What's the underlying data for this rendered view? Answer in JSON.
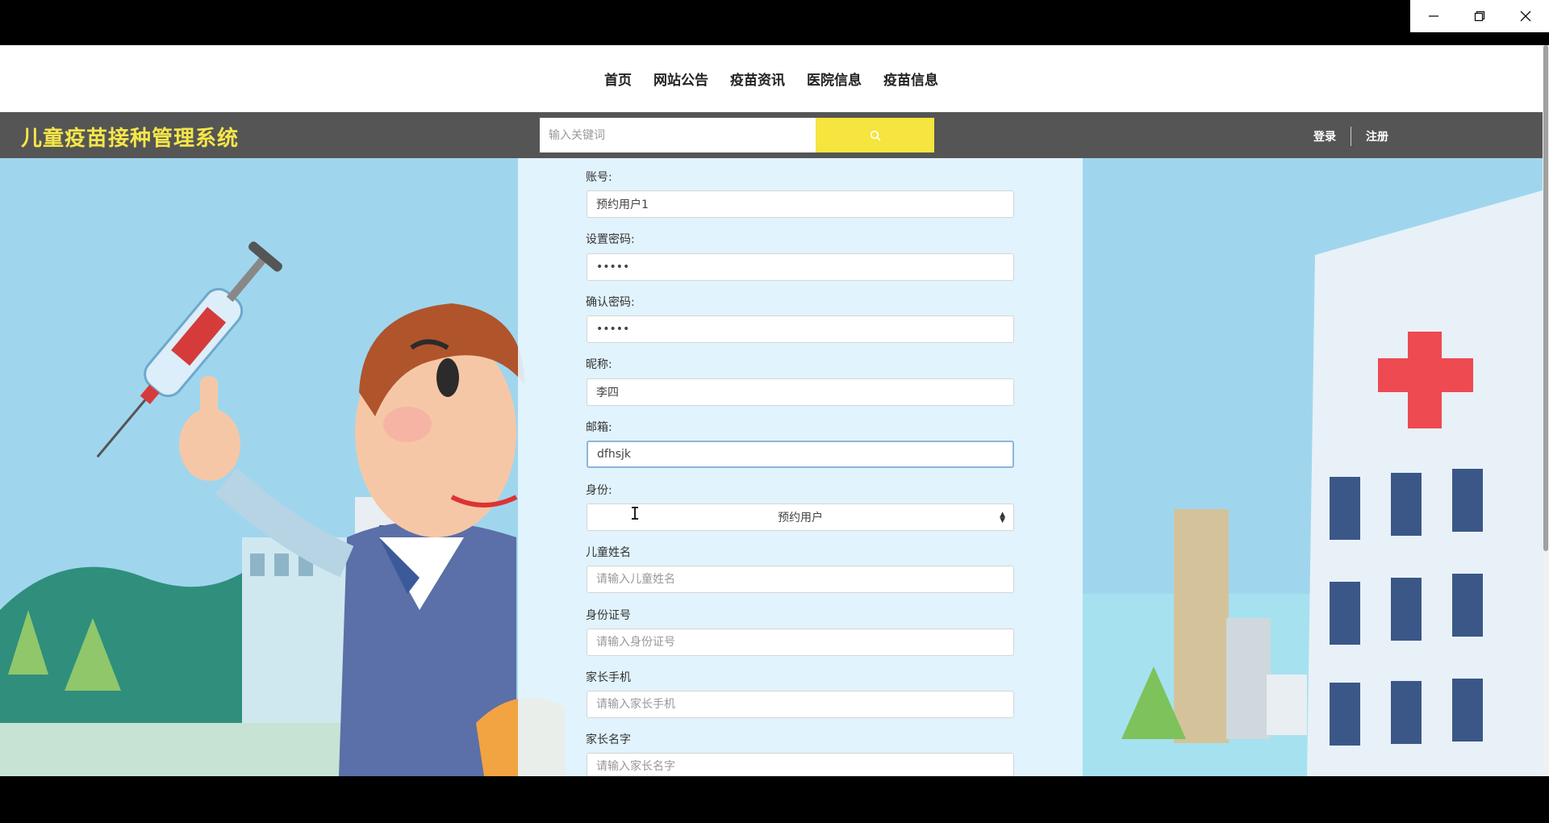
{
  "window": {
    "minimize_icon": "minimize-icon",
    "restore_icon": "restore-icon",
    "close_icon": "close-icon"
  },
  "nav": {
    "items": [
      "首页",
      "网站公告",
      "疫苗资讯",
      "医院信息",
      "疫苗信息"
    ]
  },
  "header": {
    "title": "儿童疫苗接种管理系统",
    "search_placeholder": "输入关键词",
    "search_icon": "search-icon",
    "login": "登录",
    "register": "注册"
  },
  "colors": {
    "title": "#f5e64a",
    "header_bg": "#555555",
    "search_button": "#f6e43f",
    "scene_bg": "#9fd6ee"
  },
  "form": {
    "account": {
      "label": "账号:",
      "value": "预约用户1"
    },
    "password": {
      "label": "设置密码:",
      "value": "•••••"
    },
    "confirm_password": {
      "label": "确认密码:",
      "value": "•••••"
    },
    "nickname": {
      "label": "昵称:",
      "value": "李四"
    },
    "email": {
      "label": "邮箱:",
      "value": "dfhsjk"
    },
    "role": {
      "label": "身份:",
      "value": "预约用户"
    },
    "child_name": {
      "label": "儿童姓名",
      "placeholder": "请输入儿童姓名"
    },
    "id_number": {
      "label": "身份证号",
      "placeholder": "请输入身份证号"
    },
    "parent_phone": {
      "label": "家长手机",
      "placeholder": "请输入家长手机"
    },
    "parent_name": {
      "label": "家长名字",
      "placeholder": "请输入家长名字"
    }
  }
}
